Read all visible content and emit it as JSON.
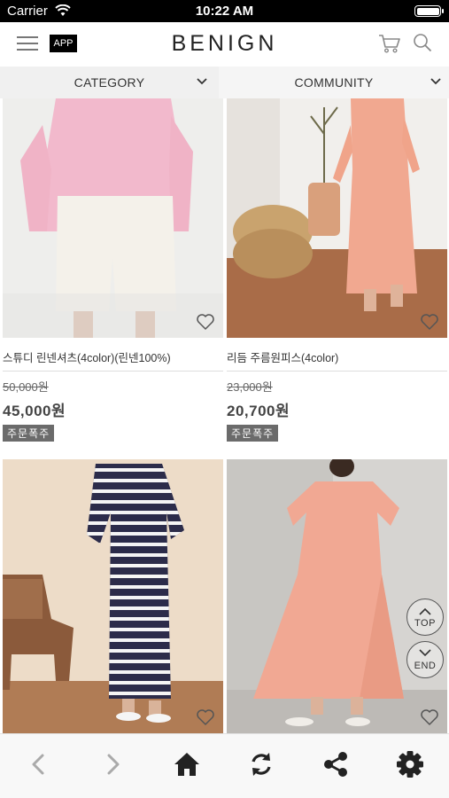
{
  "status_bar": {
    "carrier": "Carrier",
    "time": "10:22 AM"
  },
  "header": {
    "app_badge": "APP",
    "logo": "BENIGN"
  },
  "tabs": [
    {
      "label": "CATEGORY"
    },
    {
      "label": "COMMUNITY"
    }
  ],
  "products": [
    {
      "name": "스튜디 린넨셔츠(4color)(린넨100%)",
      "original_price": "50,000원",
      "price": "45,000원",
      "badge": "주문폭주"
    },
    {
      "name": "리듬 주름원피스(4color)",
      "original_price": "23,000원",
      "price": "20,700원",
      "badge": "주문폭주"
    },
    {
      "name": "",
      "original_price": "",
      "price": "",
      "badge": ""
    },
    {
      "name": "",
      "original_price": "",
      "price": "",
      "badge": ""
    }
  ],
  "scroll_buttons": {
    "top": "TOP",
    "end": "END"
  },
  "icons": [
    "wifi-icon",
    "battery-icon",
    "menu-icon",
    "cart-icon",
    "search-icon",
    "chevron-down-icon",
    "heart-icon",
    "back-icon",
    "forward-icon",
    "home-icon",
    "refresh-icon",
    "share-icon",
    "settings-icon"
  ],
  "colors": {
    "accent": "#000000",
    "badge_bg": "#6b6b6b",
    "tab_bg": "#f2f2f2"
  }
}
